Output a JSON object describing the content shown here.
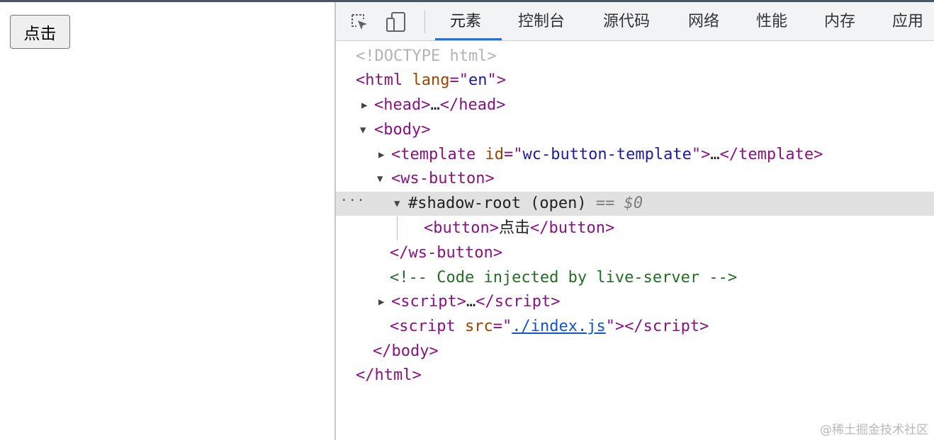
{
  "page": {
    "button_label": "点击"
  },
  "devtools": {
    "tabs": [
      "元素",
      "控制台",
      "源代码",
      "网络",
      "性能",
      "内存",
      "应用"
    ],
    "active_tab": "元素",
    "icons": {
      "inspect": "inspect-element-icon",
      "device": "device-toolbar-icon"
    }
  },
  "dom": {
    "doctype": "<!DOCTYPE html>",
    "html_tag": "html",
    "html_attr_name": "lang",
    "html_attr_value": "en",
    "head_tag": "head",
    "body_tag": "body",
    "template_tag": "template",
    "template_attr_name": "id",
    "template_attr_value": "wc-button-template",
    "ws_button_tag": "ws-button",
    "shadow_root": "#shadow-root (open)",
    "shadow_eq": "==",
    "shadow_ref": "$0",
    "button_tag": "button",
    "button_text": "点击",
    "comment": "<!-- Code injected by live-server -->",
    "script_tag": "script",
    "script_attr_name": "src",
    "script_attr_value": "./index.js",
    "ellipsis": "…",
    "more_dots": "···"
  },
  "watermark": "@稀土掘金技术社区",
  "colors": {
    "tag": "#881280",
    "attr": "#994500",
    "value": "#1a1aa6",
    "comment": "#236e25",
    "link": "#1155cc",
    "active_tab_underline": "#1a73e8"
  }
}
